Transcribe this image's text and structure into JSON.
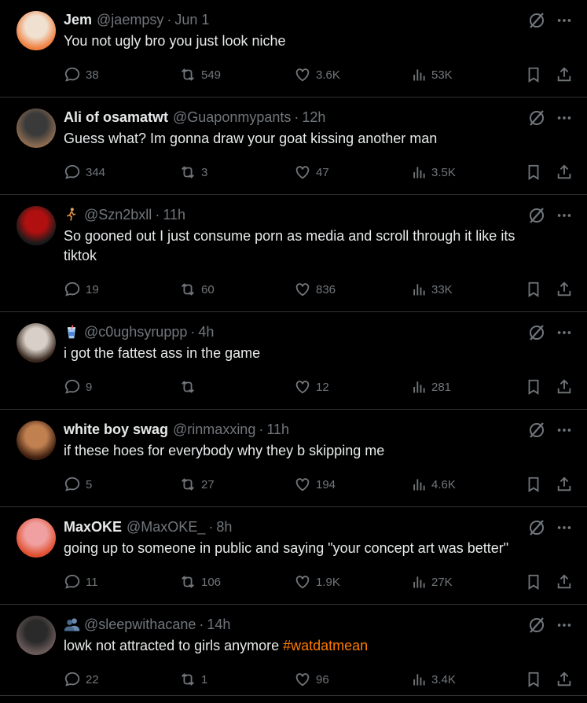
{
  "tweets": [
    {
      "name": "Jem",
      "handle": "@jaempsy",
      "time": "Jun 1",
      "text": "You not ugly bro you just look niche",
      "hashtag": "",
      "replies": "38",
      "retweets": "549",
      "likes": "3.6K",
      "views": "53K",
      "avatar_colors": [
        "#f0e0d0",
        "#f08040"
      ],
      "height": 124
    },
    {
      "name": "Ali of osamatwt",
      "handle": "@Guaponmypants",
      "time": "12h",
      "text": "Guess what? Im gonna draw your goat kissing another man",
      "hashtag": "",
      "replies": "344",
      "retweets": "3",
      "likes": "47",
      "views": "3.5K",
      "avatar_colors": [
        "#3a3a3a",
        "#8a6a50"
      ],
      "height": 124
    },
    {
      "name": "",
      "emoji": "runner",
      "handle": "@Szn2bxll",
      "time": "11h",
      "text": "So gooned out I just consume porn as media and scroll through it like its tiktok",
      "hashtag": "",
      "replies": "19",
      "retweets": "60",
      "likes": "836",
      "views": "33K",
      "avatar_colors": [
        "#b01010",
        "#1a1a1a"
      ],
      "height": 149
    },
    {
      "name": "",
      "emoji": "cup",
      "handle": "@c0ughsyruppp",
      "time": "4h",
      "text": "i got the fattest ass in the game",
      "hashtag": "",
      "replies": "9",
      "retweets": "",
      "likes": "12",
      "views": "281",
      "avatar_colors": [
        "#d8d0c8",
        "#3a2a20"
      ],
      "height": 124
    },
    {
      "name": "white boy swag",
      "handle": "@rinmaxxing",
      "time": "11h",
      "text": "if these hoes for everybody why they b skipping me",
      "hashtag": "",
      "replies": "5",
      "retweets": "27",
      "likes": "194",
      "views": "4.6K",
      "avatar_colors": [
        "#c08050",
        "#402010"
      ],
      "height": 124
    },
    {
      "name": "MaxOKE",
      "handle": "@MaxOKE_",
      "time": "8h",
      "text": "going up to someone in public and saying \"your concept art was better\"",
      "hashtag": "",
      "replies": "11",
      "retweets": "106",
      "likes": "1.9K",
      "views": "27K",
      "avatar_colors": [
        "#f0a0a0",
        "#e05030"
      ],
      "height": 124
    },
    {
      "name": "",
      "emoji": "people",
      "handle": "@sleepwithacane",
      "time": "14h",
      "text": "lowk not attracted to girls anymore ",
      "hashtag": "#watdatmean",
      "replies": "22",
      "retweets": "1",
      "likes": "96",
      "views": "3.4K",
      "avatar_colors": [
        "#2a2a2a",
        "#6a5a5a"
      ],
      "height": 116
    }
  ],
  "dot": "·",
  "colors": {
    "background": "#000000",
    "text": "#e7e9ea",
    "muted": "#71767b",
    "border": "#2f3336",
    "hashtag": "#ff7a00"
  }
}
